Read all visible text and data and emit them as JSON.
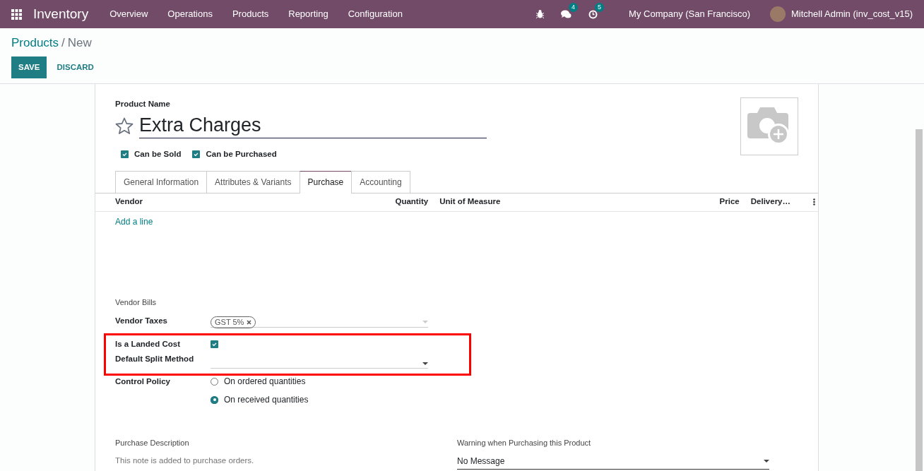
{
  "navbar": {
    "app_name": "Inventory",
    "menu": [
      "Overview",
      "Operations",
      "Products",
      "Reporting",
      "Configuration"
    ],
    "messages_count": "4",
    "activities_count": "5",
    "company": "My Company (San Francisco)",
    "user": "Mitchell Admin (inv_cost_v15)"
  },
  "breadcrumb": {
    "parent": "Products",
    "separator": "/",
    "current": "New"
  },
  "actions": [
    "SAVE",
    "DISCARD"
  ],
  "form": {
    "name_label": "Product Name",
    "name": "Extra Charges",
    "favorite": false,
    "options": [
      {
        "label": "Can be Sold",
        "checked": true
      },
      {
        "label": "Can be Purchased",
        "checked": true
      }
    ],
    "tabs": [
      {
        "label": "General Information",
        "selected": false
      },
      {
        "label": "Attributes & Variants",
        "selected": false
      },
      {
        "label": "Purchase",
        "selected": true
      },
      {
        "label": "Accounting",
        "selected": false
      }
    ],
    "vendor_table": {
      "columns": [
        "Vendor",
        "Quantity",
        "Unit of Measure",
        "Price",
        "Delivery…"
      ],
      "add_line": "Add a line"
    },
    "section_title": "Vendor Bills",
    "vendor_taxes_label": "Vendor Taxes",
    "vendor_taxes": [
      "GST 5%"
    ],
    "landed_cost_label": "Is a Landed Cost",
    "landed_cost": true,
    "split_method_label": "Default Split Method",
    "control_policy_label": "Control Policy",
    "control_policy": [
      {
        "label": "On ordered quantities",
        "selected": false
      },
      {
        "label": "On received quantities",
        "selected": true
      }
    ],
    "purchase_description_label": "Purchase Description",
    "purchase_description_placeholder": "This note is added to purchase orders.",
    "warning_label": "Warning when Purchasing this Product",
    "warning": "No Message"
  }
}
